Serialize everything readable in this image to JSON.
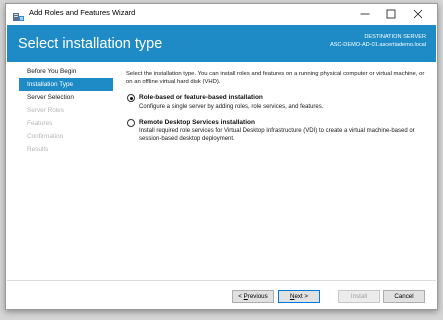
{
  "window": {
    "title": "Add Roles and Features Wizard"
  },
  "header": {
    "title": "Select installation type",
    "destination_label": "DESTINATION SERVER",
    "destination_server": "ASC-DEMO-AD-01.ascertiademo.local",
    "accent_color": "#1e8bc7"
  },
  "nav": {
    "items": [
      {
        "label": "Before You Begin",
        "state": "normal"
      },
      {
        "label": "Installation Type",
        "state": "active"
      },
      {
        "label": "Server Selection",
        "state": "normal"
      },
      {
        "label": "Server Roles",
        "state": "disabled"
      },
      {
        "label": "Features",
        "state": "disabled"
      },
      {
        "label": "Confirmation",
        "state": "disabled"
      },
      {
        "label": "Results",
        "state": "disabled"
      }
    ]
  },
  "content": {
    "intro": "Select the installation type. You can install roles and features on a running physical computer or virtual machine, or on an offline virtual hard disk (VHD).",
    "options": [
      {
        "title": "Role-based or feature-based installation",
        "description": "Configure a single server by adding roles, role services, and features.",
        "selected": true
      },
      {
        "title": "Remote Desktop Services installation",
        "description": "Install required role services for Virtual Desktop Infrastructure (VDI) to create a virtual machine-based or session-based desktop deployment.",
        "selected": false
      }
    ]
  },
  "footer": {
    "previous_prefix": "< ",
    "previous_accel": "P",
    "previous_rest": "revious",
    "next_accel": "N",
    "next_rest": "ext >",
    "install_label": "Install",
    "cancel_label": "Cancel"
  }
}
